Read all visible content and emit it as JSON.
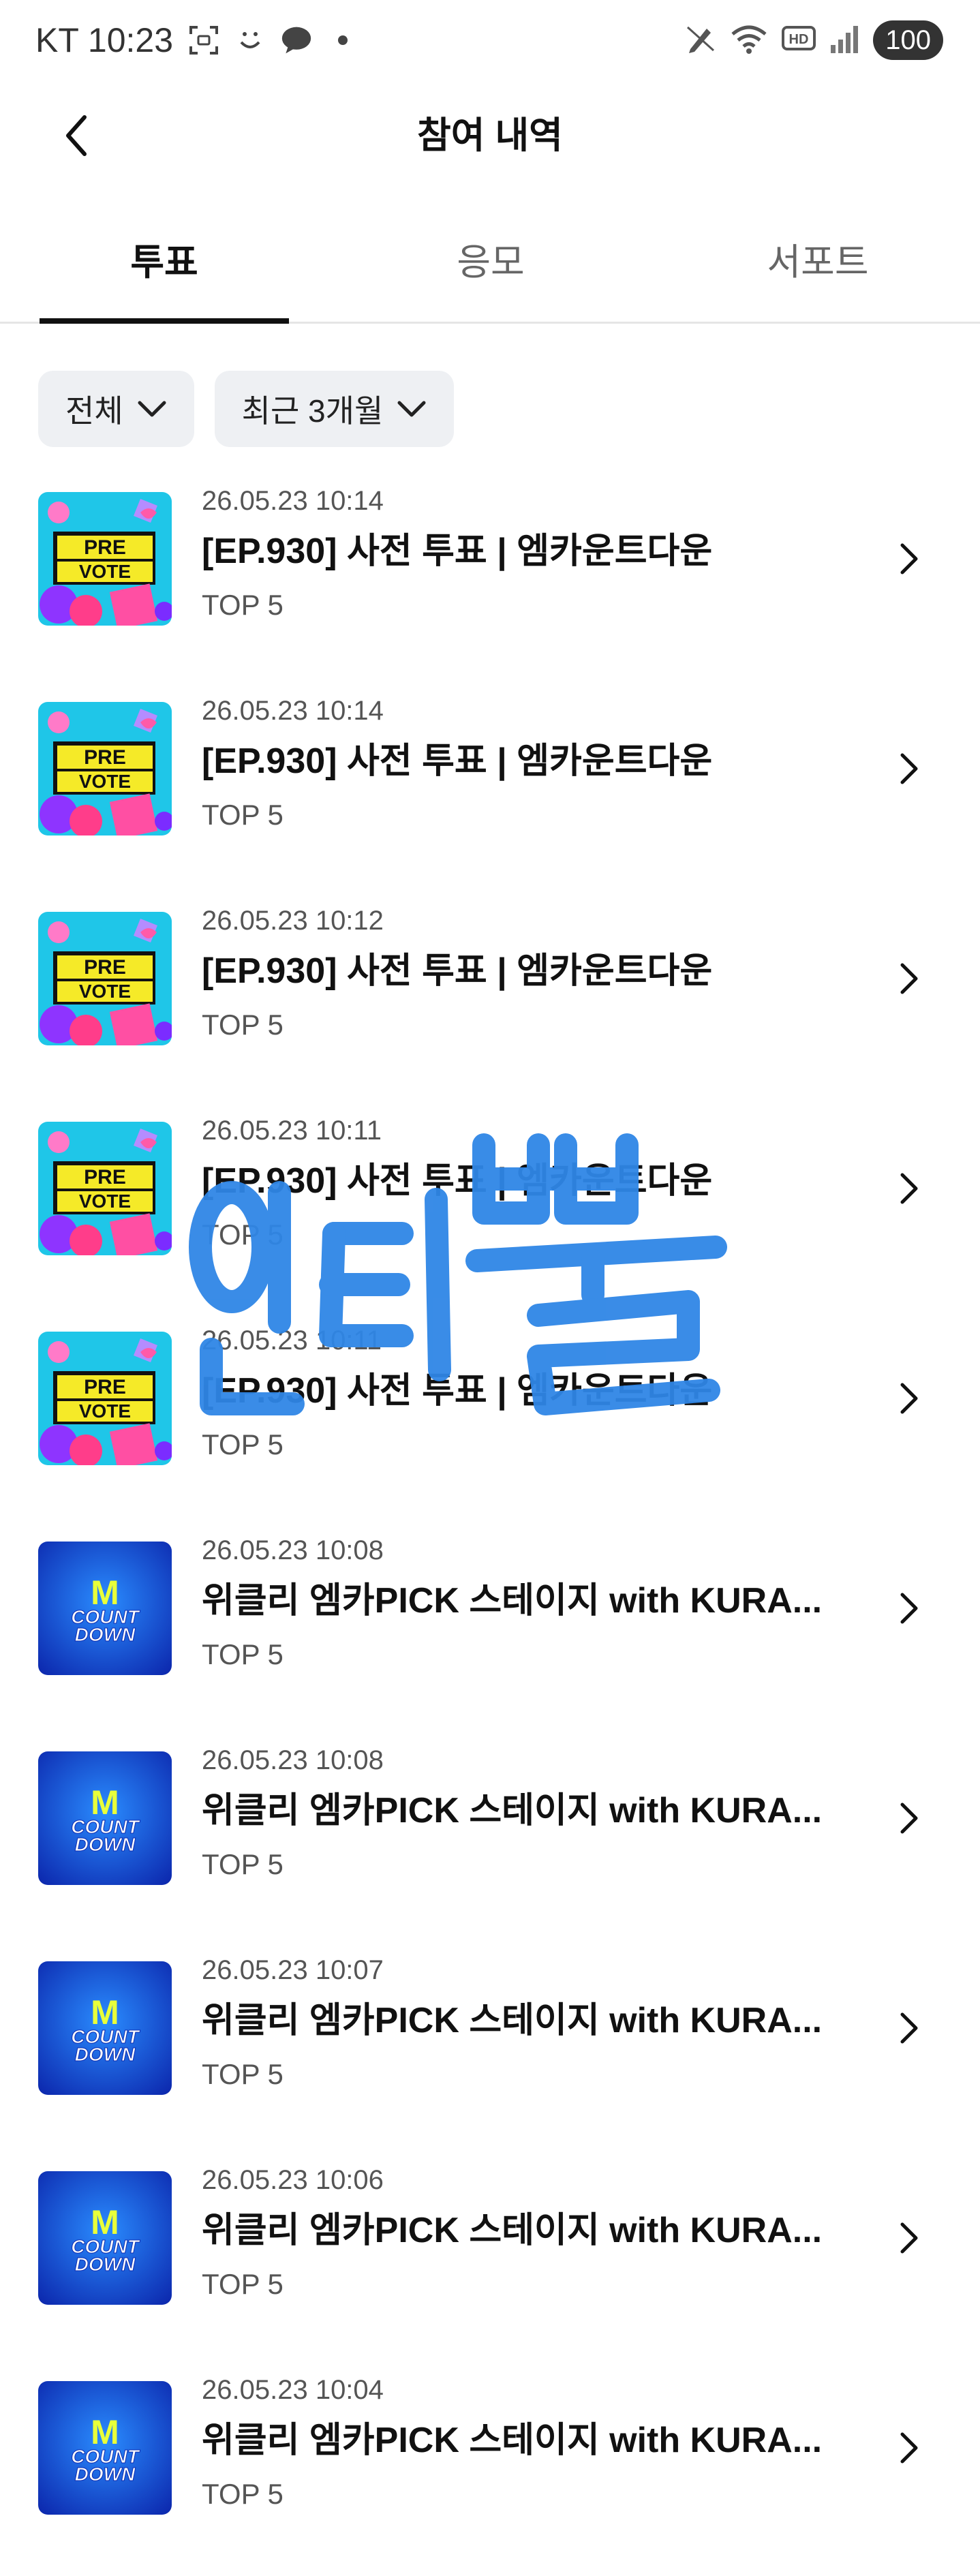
{
  "status_bar": {
    "carrier_time": "KT 10:23",
    "battery": "100",
    "hd_label": "HD"
  },
  "header": {
    "title": "참여 내역"
  },
  "tabs": [
    {
      "label": "투표",
      "active": true
    },
    {
      "label": "응모",
      "active": false
    },
    {
      "label": "서포트",
      "active": false
    }
  ],
  "filters": {
    "type": "전체",
    "period": "최근 3개월"
  },
  "thumbnails": {
    "prevote_line1": "PRE",
    "prevote_line2": "VOTE",
    "mcd_logo_m": "M",
    "mcd_logo_line1": "COUNT",
    "mcd_logo_line2": "DOWN"
  },
  "items": [
    {
      "date": "26.05.23 10:14",
      "title": "[EP.930] 사전 투표 | 엠카운트다운",
      "subtitle": "TOP 5",
      "thumb": "prevote"
    },
    {
      "date": "26.05.23 10:14",
      "title": "[EP.930] 사전 투표 | 엠카운트다운",
      "subtitle": "TOP 5",
      "thumb": "prevote"
    },
    {
      "date": "26.05.23 10:12",
      "title": "[EP.930] 사전 투표 | 엠카운트다운",
      "subtitle": "TOP 5",
      "thumb": "prevote"
    },
    {
      "date": "26.05.23 10:11",
      "title": "[EP.930] 사전 투표 | 엠카운트다운",
      "subtitle": "TOP 5",
      "thumb": "prevote"
    },
    {
      "date": "26.05.23 10:11",
      "title": "[EP.930] 사전 투표 | 엠카운트다운",
      "subtitle": "TOP 5",
      "thumb": "prevote"
    },
    {
      "date": "26.05.23 10:08",
      "title": "위클리 엠카PICK 스테이지 with KURA...",
      "subtitle": "TOP 5",
      "thumb": "mcountdown"
    },
    {
      "date": "26.05.23 10:08",
      "title": "위클리 엠카PICK 스테이지 with KURA...",
      "subtitle": "TOP 5",
      "thumb": "mcountdown"
    },
    {
      "date": "26.05.23 10:07",
      "title": "위클리 엠카PICK 스테이지 with KURA...",
      "subtitle": "TOP 5",
      "thumb": "mcountdown"
    },
    {
      "date": "26.05.23 10:06",
      "title": "위클리 엠카PICK 스테이지 with KURA...",
      "subtitle": "TOP 5",
      "thumb": "mcountdown"
    },
    {
      "date": "26.05.23 10:04",
      "title": "위클리 엠카PICK 스테이지 with KURA...",
      "subtitle": "TOP 5",
      "thumb": "mcountdown"
    }
  ],
  "watermark": {
    "text": "인티뿔",
    "color": "#2f86e6"
  },
  "colors": {
    "text_primary": "#111111",
    "text_secondary": "#555555",
    "chip_bg": "#eef0f3",
    "divider": "#e5e5e5"
  }
}
